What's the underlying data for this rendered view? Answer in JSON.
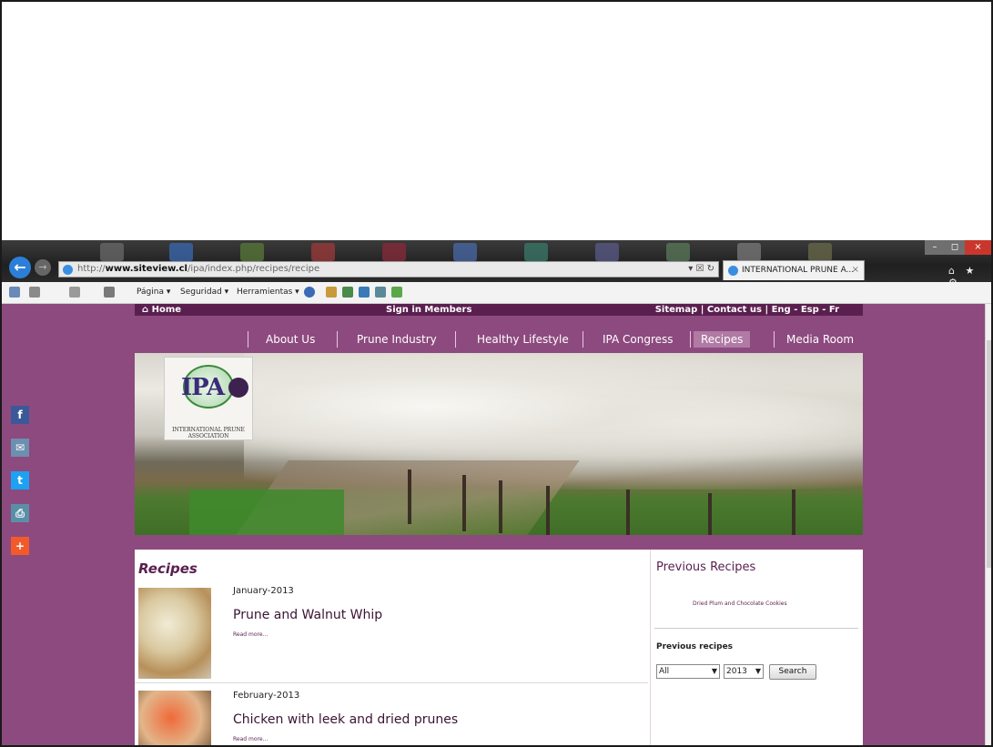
{
  "browser": {
    "url_host": "www.siteview.cl",
    "url_prefix": "http://",
    "url_rest": "/ipa/index.php/recipes/recipe",
    "tab_title": "INTERNATIONAL PRUNE A...",
    "tab_close": "×",
    "address_tools": "▾ ☒ ↻",
    "window_min": "–",
    "window_max": "◻",
    "window_close": "×",
    "home_star_gear": "⌂ ★ ⚙",
    "commands": [
      "Página ▾",
      "Seguridad ▾",
      "Herramientas ▾"
    ],
    "back_glyph": "←",
    "forward_glyph": "→"
  },
  "site": {
    "topstrip": {
      "home": "⌂ Home",
      "signin": "Sign in Members",
      "links": "Sitemap | Contact us | Eng - Esp - Fr"
    },
    "nav": [
      {
        "label": "About Us"
      },
      {
        "label": "Prune Industry"
      },
      {
        "label": "Healthy Lifestyle"
      },
      {
        "label": "IPA Congress"
      },
      {
        "label": "Recipes"
      },
      {
        "label": "Media Room"
      }
    ],
    "logo": {
      "initials": "IPA",
      "caption": "INTERNATIONAL PRUNE ASSOCIATION"
    },
    "content": {
      "title": "Recipes",
      "recipes": [
        {
          "date": "January-2013",
          "title": "Prune and Walnut Whip",
          "read_more": "Read more..."
        },
        {
          "date": "February-2013",
          "title": "Chicken with leek and dried prunes",
          "read_more": "Read more..."
        }
      ]
    },
    "sidebar": {
      "title": "Previous Recipes",
      "link": "Dried Plum and Chocolate Cookies",
      "sub_title": "Previous recipes",
      "filter_category": "All",
      "filter_year": "2013",
      "search_label": "Search"
    },
    "social": [
      {
        "icon": "facebook-icon",
        "glyph": "f"
      },
      {
        "icon": "email-icon",
        "glyph": "✉"
      },
      {
        "icon": "twitter-icon",
        "glyph": "t"
      },
      {
        "icon": "print-icon",
        "glyph": "⎙"
      },
      {
        "icon": "share-plus-icon",
        "glyph": "+"
      }
    ]
  },
  "colors": {
    "site_background": "#8d4a7f",
    "topstrip": "#5a1f4f",
    "accent_title": "#5a1f4f"
  }
}
